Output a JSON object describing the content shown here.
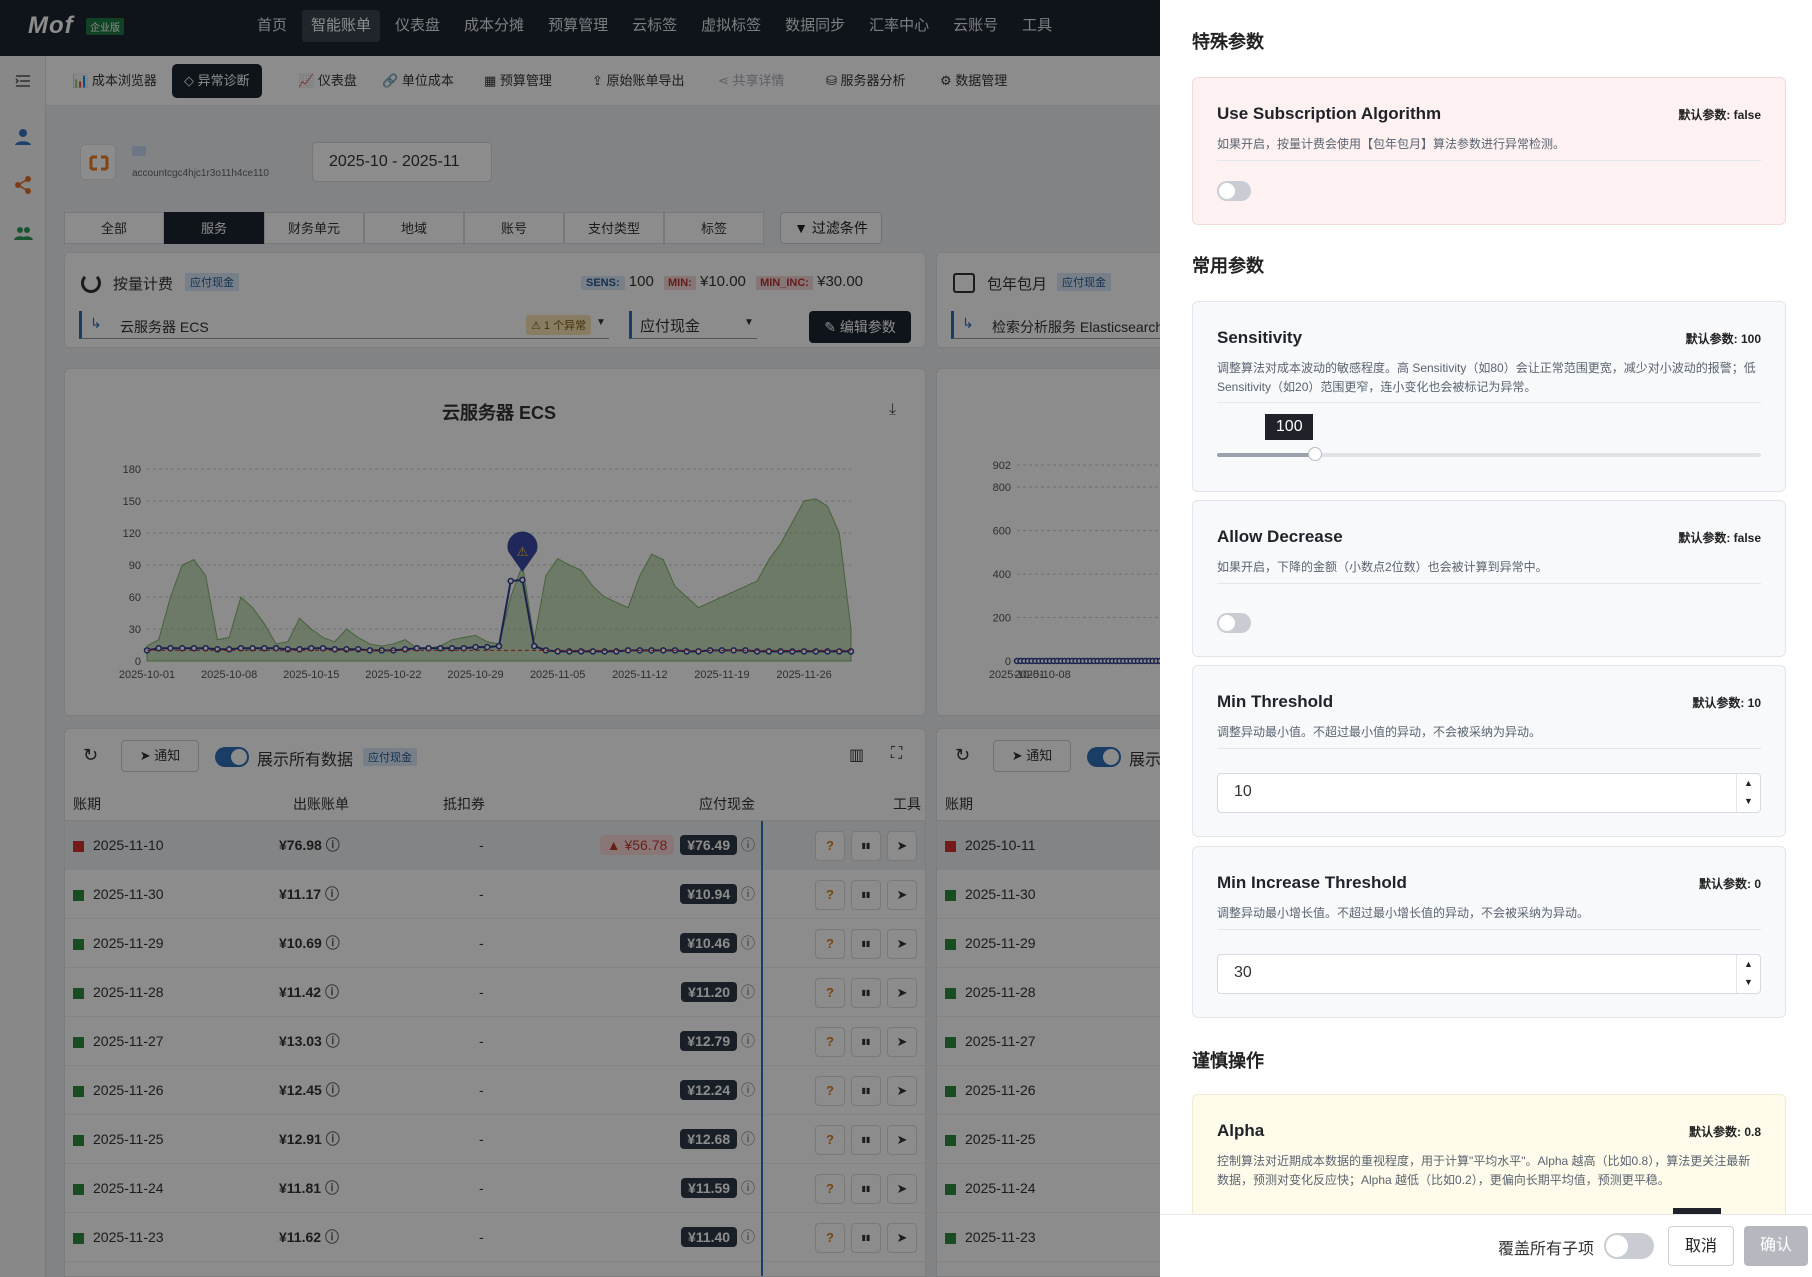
{
  "topbar": {
    "logo": "Mof",
    "badge": "企业版",
    "nav": [
      "首页",
      "智能账单",
      "仪表盘",
      "成本分摊",
      "预算管理",
      "云标签",
      "虚拟标签",
      "数据同步",
      "汇率中心",
      "云账号",
      "工具"
    ]
  },
  "subtabs": [
    "成本浏览器",
    "异常诊断",
    "仪表盘",
    "单位成本",
    "预算管理",
    "原始账单导出",
    "共享详情",
    "服务器分析",
    "数据管理"
  ],
  "account": {
    "id": "accountcgc4hjc1r3o11h4ce110",
    "date_range": "2025-10 - 2025-11"
  },
  "segments": [
    "全部",
    "服务",
    "财务单元",
    "地域",
    "账号",
    "支付类型",
    "标签"
  ],
  "filter_label": "过滤条件",
  "left_panel": {
    "title": "按量计费",
    "tag": "应付现金",
    "sens_label": "SENS:",
    "sens_val": "100",
    "min_label": "MIN:",
    "min_val": "¥10.00",
    "mininc_label": "MIN_INC:",
    "mininc_val": "¥30.00",
    "service": "云服务器 ECS",
    "anomaly_count": "⚠ 1 个异常",
    "metric": "应付现金",
    "edit_btn": "编辑参数"
  },
  "right_panel": {
    "title": "包年包月",
    "tag": "应付现金",
    "service": "检索分析服务 Elasticsearch",
    "first_row_date": "2025-10-11"
  },
  "chart_data": [
    {
      "type": "line",
      "title": "云服务器 ECS",
      "x_ticks": [
        "2025-10-01",
        "2025-10-08",
        "2025-10-15",
        "2025-10-22",
        "2025-10-29",
        "2025-11-05",
        "2025-11-12",
        "2025-11-19",
        "2025-11-26"
      ],
      "y_ticks": [
        0,
        30,
        60,
        90,
        120,
        150,
        180
      ],
      "ylim": [
        0,
        180
      ],
      "series": [
        {
          "values": [
            10,
            12,
            12,
            12,
            12,
            12,
            11,
            11,
            12,
            12,
            12,
            12,
            11,
            11,
            12,
            12,
            11,
            11,
            11,
            10,
            10,
            10,
            11,
            12,
            12,
            12,
            12,
            12,
            13,
            13,
            14,
            75,
            76,
            14,
            10,
            9,
            9,
            9,
            9,
            9,
            9,
            10,
            10,
            10,
            10,
            10,
            9,
            9,
            10,
            10,
            10,
            10,
            9,
            9,
            9,
            9,
            9,
            9,
            9,
            9,
            9
          ]
        },
        {
          "values": [
            14,
            20,
            60,
            90,
            95,
            80,
            20,
            22,
            60,
            50,
            35,
            16,
            18,
            40,
            30,
            22,
            18,
            30,
            22,
            16,
            14,
            16,
            20,
            12,
            12,
            14,
            20,
            22,
            24,
            18,
            16,
            60,
            90,
            20,
            80,
            96,
            90,
            85,
            70,
            60,
            55,
            50,
            80,
            100,
            95,
            70,
            60,
            50,
            55,
            60,
            65,
            70,
            75,
            95,
            110,
            130,
            150,
            152,
            145,
            120,
            30
          ]
        }
      ]
    },
    {
      "type": "line",
      "y_ticks": [
        0,
        200,
        400,
        600,
        800,
        902
      ],
      "ylim": [
        0,
        902
      ],
      "x_ticks": [
        "2025-10-01",
        "2025-10-08"
      ],
      "series": [
        {
          "values": [
            0,
            0,
            0,
            0,
            0,
            0,
            0,
            0,
            0,
            0,
            0,
            0,
            0,
            0,
            0,
            0,
            0,
            0,
            0,
            0,
            0,
            0,
            0,
            0,
            0,
            0,
            0,
            0,
            0,
            0,
            0,
            0,
            0,
            0,
            0,
            0,
            0,
            0,
            0,
            0,
            0,
            0,
            0,
            0,
            0,
            0,
            0,
            0,
            0,
            0,
            0,
            0,
            0,
            0,
            0,
            0,
            0,
            0,
            0,
            0,
            0
          ]
        }
      ]
    }
  ],
  "table_toolbar": {
    "notify": "通知",
    "show_all": "展示所有数据",
    "tag": "应付现金"
  },
  "table": {
    "headers": [
      "账期",
      "出账账单",
      "抵扣券",
      "应付现金",
      "工具"
    ],
    "rows": [
      {
        "date": "2025-11-10",
        "bill": "¥76.98",
        "coupon": "-",
        "delta": "▲ ¥56.78",
        "cash": "¥76.49",
        "flag": "red"
      },
      {
        "date": "2025-11-30",
        "bill": "¥11.17",
        "coupon": "-",
        "delta": "",
        "cash": "¥10.94",
        "flag": "green"
      },
      {
        "date": "2025-11-29",
        "bill": "¥10.69",
        "coupon": "-",
        "delta": "",
        "cash": "¥10.46",
        "flag": "green"
      },
      {
        "date": "2025-11-28",
        "bill": "¥11.42",
        "coupon": "-",
        "delta": "",
        "cash": "¥11.20",
        "flag": "green"
      },
      {
        "date": "2025-11-27",
        "bill": "¥13.03",
        "coupon": "-",
        "delta": "",
        "cash": "¥12.79",
        "flag": "green"
      },
      {
        "date": "2025-11-26",
        "bill": "¥12.45",
        "coupon": "-",
        "delta": "",
        "cash": "¥12.24",
        "flag": "green"
      },
      {
        "date": "2025-11-25",
        "bill": "¥12.91",
        "coupon": "-",
        "delta": "",
        "cash": "¥12.68",
        "flag": "green"
      },
      {
        "date": "2025-11-24",
        "bill": "¥11.81",
        "coupon": "-",
        "delta": "",
        "cash": "¥11.59",
        "flag": "green"
      },
      {
        "date": "2025-11-23",
        "bill": "¥11.62",
        "coupon": "-",
        "delta": "",
        "cash": "¥11.40",
        "flag": "green"
      }
    ]
  },
  "right_table_dates": [
    "2025-10-11",
    "2025-11-30",
    "2025-11-29",
    "2025-11-28",
    "2025-11-27",
    "2025-11-26",
    "2025-11-25",
    "2025-11-24",
    "2025-11-23"
  ],
  "drawer": {
    "special_title": "特殊参数",
    "common_title": "常用参数",
    "careful_title": "谨慎操作",
    "params": {
      "subscription": {
        "title": "Use Subscription Algorithm",
        "default": "默认参数: false",
        "desc": "如果开启，按量计费会使用【包年包月】算法参数进行异常检测。",
        "enabled": false
      },
      "sensitivity": {
        "title": "Sensitivity",
        "default": "默认参数: 100",
        "desc": "调整算法对成本波动的敏感程度。高 Sensitivity（如80）会让正常范围更宽，减少对小波动的报警；低 Sensitivity（如20）范围更窄，连小变化也会被标记为异常。",
        "value": "100",
        "slider_fraction": 0.18
      },
      "allow_decrease": {
        "title": "Allow Decrease",
        "default": "默认参数: false",
        "desc": "如果开启，下降的金额（小数点2位数）也会被计算到异常中。",
        "enabled": false
      },
      "min_threshold": {
        "title": "Min Threshold",
        "default": "默认参数: 10",
        "desc": "调整异动最小值。不超过最小值的异动，不会被采纳为异动。",
        "value": "10"
      },
      "min_increase": {
        "title": "Min Increase Threshold",
        "default": "默认参数: 0",
        "desc": "调整异动最小增长值。不超过最小增长值的异动，不会被采纳为异动。",
        "value": "30"
      },
      "alpha": {
        "title": "Alpha",
        "default": "默认参数: 0.8",
        "desc": "控制算法对近期成本数据的重视程度，用于计算\"平均水平\"。Alpha 越高（比如0.8），算法更关注最新数据，预测对变化反应快；Alpha 越低（比如0.2），更偏向长期平均值，预测更平稳。"
      }
    },
    "footer": {
      "cover_label": "覆盖所有子项",
      "cancel": "取消",
      "confirm": "确认"
    }
  }
}
